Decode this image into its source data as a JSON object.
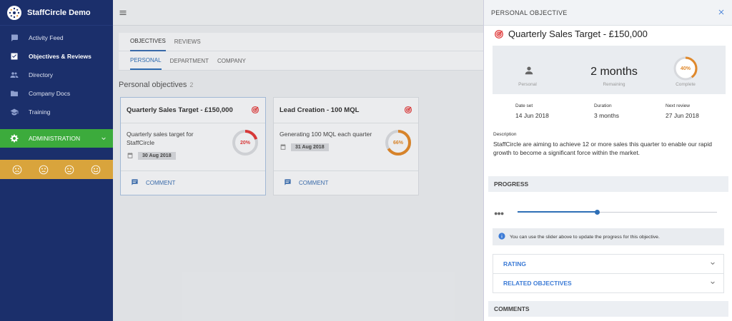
{
  "brand": {
    "name": "StaffCircle Demo"
  },
  "sidebar": {
    "items": [
      {
        "label": "Activity Feed",
        "icon": "chat-icon"
      },
      {
        "label": "Objectives & Reviews",
        "icon": "checkbox-icon"
      },
      {
        "label": "Directory",
        "icon": "people-icon"
      },
      {
        "label": "Company Docs",
        "icon": "folder-icon"
      },
      {
        "label": "Training",
        "icon": "graduation-cap-icon"
      }
    ],
    "admin_label": "ADMINISTRATION",
    "moods": [
      "very-sad-icon",
      "sad-icon",
      "neutral-icon",
      "happy-icon"
    ]
  },
  "main": {
    "tabs": [
      "OBJECTIVES",
      "REVIEWS"
    ],
    "subtabs": [
      "PERSONAL",
      "DEPARTMENT",
      "COMPANY"
    ],
    "section_title": "Personal objectives",
    "section_count": "2",
    "cards": [
      {
        "title": "Quarterly Sales Target - £150,000",
        "desc": "Quarterly sales target for StaffCircle",
        "date": "30 Aug 2018",
        "progress_label": "20%",
        "progress": 20,
        "color": "#e03b3b",
        "comment_label": "COMMENT"
      },
      {
        "title": "Lead Creation - 100 MQL",
        "desc": "Generating 100 MQL each quarter",
        "date": "31 Aug 2018",
        "progress_label": "66%",
        "progress": 66,
        "color": "#e0892c",
        "comment_label": "COMMENT"
      }
    ]
  },
  "panel": {
    "header": "PERSONAL OBJECTIVE",
    "title": "Quarterly Sales Target - £150,000",
    "summary": {
      "type_label": "Personal",
      "remaining_value": "2 months",
      "remaining_label": "Remaining",
      "complete_value": "40%",
      "complete": 40,
      "complete_label": "Complete"
    },
    "meta": [
      {
        "label": "Date set",
        "value": "14 Jun 2018"
      },
      {
        "label": "Duration",
        "value": "3 months"
      },
      {
        "label": "Next review",
        "value": "27 Jun 2018"
      }
    ],
    "description_label": "Description",
    "description": "StaffCircle are aiming to achieve 12 or more sales this quarter to enable our rapid growth to become a significant force within the market.",
    "progress_title": "PROGRESS",
    "slider_value": 40,
    "info_text": "You can use the slider above to update the progress for this objective.",
    "accordions": [
      "RATING",
      "RELATED OBJECTIVES"
    ],
    "comments_title": "COMMENTS"
  },
  "colors": {
    "sidebar": "#1b2f6b",
    "accent": "#2f6fb6",
    "admin": "#3cab3c",
    "mood_bar": "#d9a43c"
  }
}
